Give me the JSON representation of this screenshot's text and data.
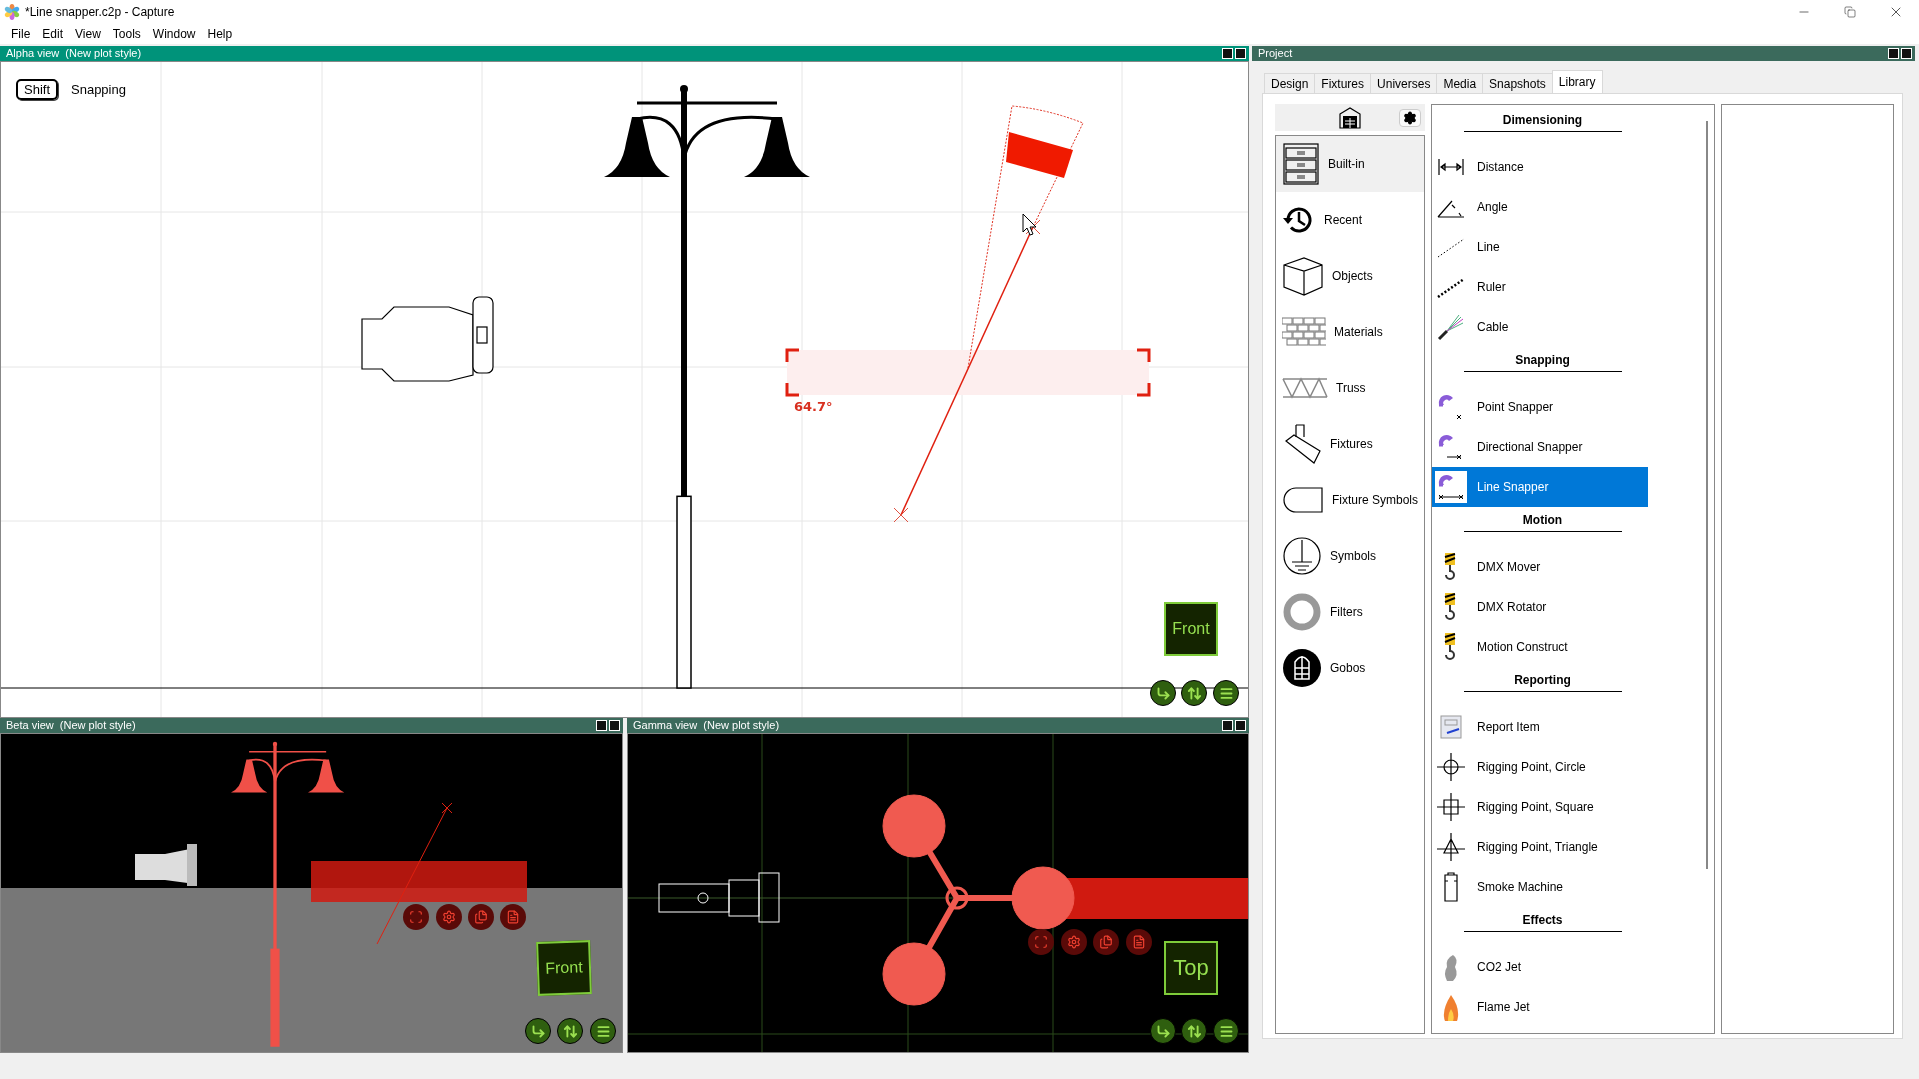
{
  "window": {
    "title": "*Line snapper.c2p - Capture"
  },
  "menu": [
    "File",
    "Edit",
    "View",
    "Tools",
    "Window",
    "Help"
  ],
  "views": [
    {
      "title": "Alpha view  (New plot style)",
      "kind": "plan",
      "active": true,
      "hint": {
        "key": "Shift",
        "label": "Snapping"
      },
      "angle": "64.7°",
      "orientation": "Front"
    },
    {
      "title": "Beta view  (New plot style)",
      "kind": "perspective",
      "active": false,
      "orientation": "Front"
    },
    {
      "title": "Gamma view  (New plot style)",
      "kind": "top",
      "active": false,
      "orientation": "Top"
    }
  ],
  "project": {
    "title": "Project",
    "tabs": [
      {
        "label": "Design",
        "selected": false
      },
      {
        "label": "Fixtures",
        "selected": false
      },
      {
        "label": "Universes",
        "selected": false
      },
      {
        "label": "Media",
        "selected": false
      },
      {
        "label": "Snapshots",
        "selected": false
      },
      {
        "label": "Library",
        "selected": true
      }
    ],
    "categories": [
      {
        "label": "Built-in",
        "selected": true
      },
      {
        "label": "Recent",
        "selected": false
      },
      {
        "label": "Objects",
        "selected": false
      },
      {
        "label": "Materials",
        "selected": false
      },
      {
        "label": "Truss",
        "selected": false
      },
      {
        "label": "Fixtures",
        "selected": false
      },
      {
        "label": "Fixture Symbols",
        "selected": false
      },
      {
        "label": "Symbols",
        "selected": false
      },
      {
        "label": "Filters",
        "selected": false
      },
      {
        "label": "Gobos",
        "selected": false
      }
    ],
    "library": [
      {
        "kind": "heading",
        "label": "Dimensioning"
      },
      {
        "kind": "item",
        "label": "Distance",
        "selected": false
      },
      {
        "kind": "item",
        "label": "Angle",
        "selected": false
      },
      {
        "kind": "item",
        "label": "Line",
        "selected": false
      },
      {
        "kind": "item",
        "label": "Ruler",
        "selected": false
      },
      {
        "kind": "item",
        "label": "Cable",
        "selected": false
      },
      {
        "kind": "heading",
        "label": "Snapping"
      },
      {
        "kind": "item",
        "label": "Point Snapper",
        "selected": false
      },
      {
        "kind": "item",
        "label": "Directional Snapper",
        "selected": false
      },
      {
        "kind": "item",
        "label": "Line Snapper",
        "selected": true
      },
      {
        "kind": "heading",
        "label": "Motion"
      },
      {
        "kind": "item",
        "label": "DMX Mover",
        "selected": false
      },
      {
        "kind": "item",
        "label": "DMX Rotator",
        "selected": false
      },
      {
        "kind": "item",
        "label": "Motion Construct",
        "selected": false
      },
      {
        "kind": "heading",
        "label": "Reporting"
      },
      {
        "kind": "item",
        "label": "Report Item",
        "selected": false
      },
      {
        "kind": "item",
        "label": "Rigging Point, Circle",
        "selected": false
      },
      {
        "kind": "item",
        "label": "Rigging Point, Square",
        "selected": false
      },
      {
        "kind": "item",
        "label": "Rigging Point, Triangle",
        "selected": false
      },
      {
        "kind": "item",
        "label": "Smoke Machine",
        "selected": false
      },
      {
        "kind": "heading",
        "label": "Effects"
      },
      {
        "kind": "item",
        "label": "CO2 Jet",
        "selected": false
      },
      {
        "kind": "item",
        "label": "Flame Jet",
        "selected": false
      }
    ]
  }
}
